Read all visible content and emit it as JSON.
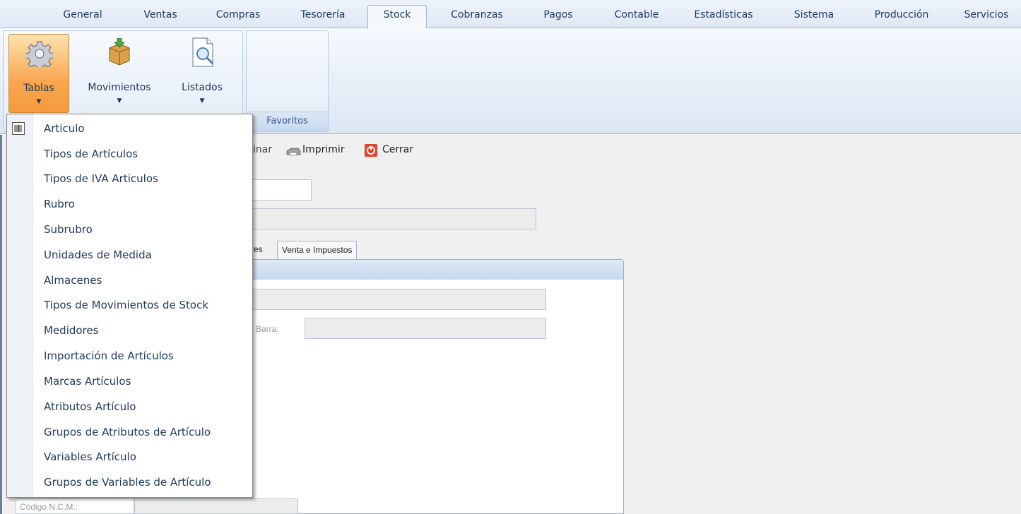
{
  "ribbon": {
    "tabs": [
      {
        "label": "General"
      },
      {
        "label": "Ventas"
      },
      {
        "label": "Compras"
      },
      {
        "label": "Tesorería"
      },
      {
        "label": "Stock"
      },
      {
        "label": "Cobranzas"
      },
      {
        "label": "Pagos"
      },
      {
        "label": "Contable"
      },
      {
        "label": "Estadísticas"
      },
      {
        "label": "Sistema"
      },
      {
        "label": "Producción"
      },
      {
        "label": "Servicios"
      }
    ],
    "active_tab": "Stock",
    "buttons": {
      "tablas": "Tablas",
      "movimientos": "Movimientos",
      "listados": "Listados"
    },
    "favorites_caption": "Favoritos"
  },
  "toolbar": {
    "eliminar_partial": "inar",
    "imprimir": "Imprimir",
    "cerrar": "Cerrar"
  },
  "form": {
    "tabs_partial": "res",
    "tab_venta": "Venta e Impuestos",
    "barcode_label_partial": "e Barra:",
    "ncm_label": "Código N.C.M.:"
  },
  "dropdown": {
    "items": [
      {
        "label": "Articulo"
      },
      {
        "label": "Tipos de Artículos"
      },
      {
        "label": "Tipos de IVA Articulos"
      },
      {
        "label": "Rubro"
      },
      {
        "label": "Subrubro"
      },
      {
        "label": "Unidades de Medida"
      },
      {
        "label": "Almacenes"
      },
      {
        "label": "Tipos de Movimientos de Stock"
      },
      {
        "label": "Medidores"
      },
      {
        "label": "Importación de Artículos"
      },
      {
        "label": "Marcas Artículos"
      },
      {
        "label": "Atributos Artículo"
      },
      {
        "label": "Grupos de Atributos de Artículo"
      },
      {
        "label": "Variables Artículo"
      },
      {
        "label": "Grupos de Variables de Artículo"
      }
    ]
  }
}
